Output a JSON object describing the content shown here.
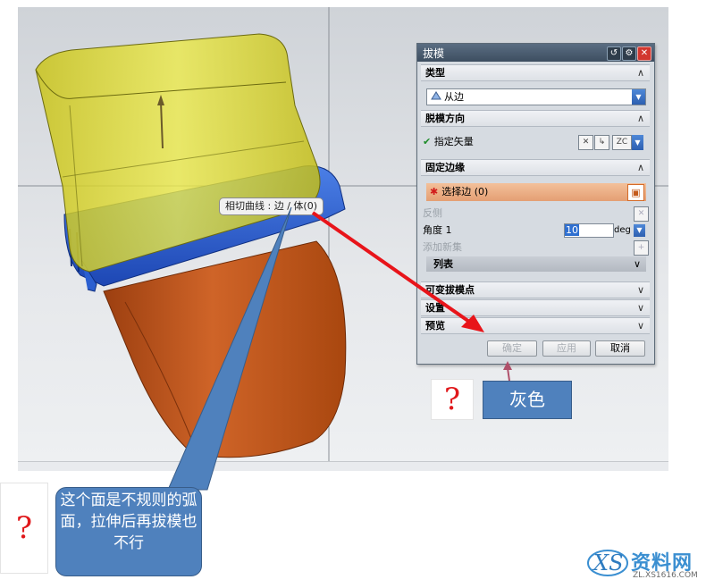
{
  "viewport": {
    "tooltip": "相切曲线 : 边 / 体(0)"
  },
  "dialog": {
    "title": "拔模",
    "sections": {
      "type": "类型",
      "direction": "脱模方向",
      "fixed_edge": "固定边缘",
      "variable": "可变拔模点",
      "settings": "设置",
      "preview": "预览"
    },
    "type_value": "从边",
    "specify_vector": "指定矢量",
    "vector_label": "ZC",
    "select_edge": "选择边 (0)",
    "reverse": "反侧",
    "angle_label": "角度 1",
    "angle_value": "10",
    "angle_unit": "deg",
    "add_set": "添加新集",
    "list": "列表",
    "buttons": {
      "ok": "确定",
      "apply": "应用",
      "cancel": "取消"
    }
  },
  "annotations": {
    "gray_label": "灰色",
    "question_mark": "?",
    "note": "这个面是不规则的弧面，拉伸后再拔模也不行"
  },
  "watermark": {
    "brand": "资料网",
    "url": "ZL.XS1616.COM"
  },
  "colors": {
    "callout_blue": "#4f81bd",
    "arrow_red": "#e8141a",
    "body_orange": "#c75a20",
    "rim_blue": "#1f55c9",
    "extrude_yellow": "#d8d41c"
  }
}
